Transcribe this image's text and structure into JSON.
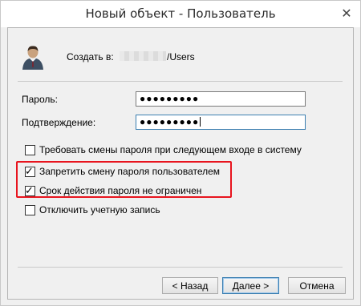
{
  "window": {
    "title": "Новый объект - Пользователь",
    "close_glyph": "✕"
  },
  "header": {
    "create_label": "Создать в:",
    "path_suffix": "/Users"
  },
  "form": {
    "password_label": "Пароль:",
    "password_value": "●●●●●●●●●",
    "confirm_label": "Подтверждение:",
    "confirm_value": "●●●●●●●●●"
  },
  "options": [
    {
      "label": "Требовать смены пароля при следующем входе в систему",
      "checked": false
    },
    {
      "label": "Запретить смену пароля пользователем",
      "checked": true
    },
    {
      "label": "Срок действия пароля не ограничен",
      "checked": true
    },
    {
      "label": "Отключить учетную запись",
      "checked": false
    }
  ],
  "buttons": {
    "back": "< Назад",
    "next": "Далее >",
    "cancel": "Отмена"
  },
  "colors": {
    "highlight": "#e8141e",
    "accent": "#3c7fb1"
  }
}
